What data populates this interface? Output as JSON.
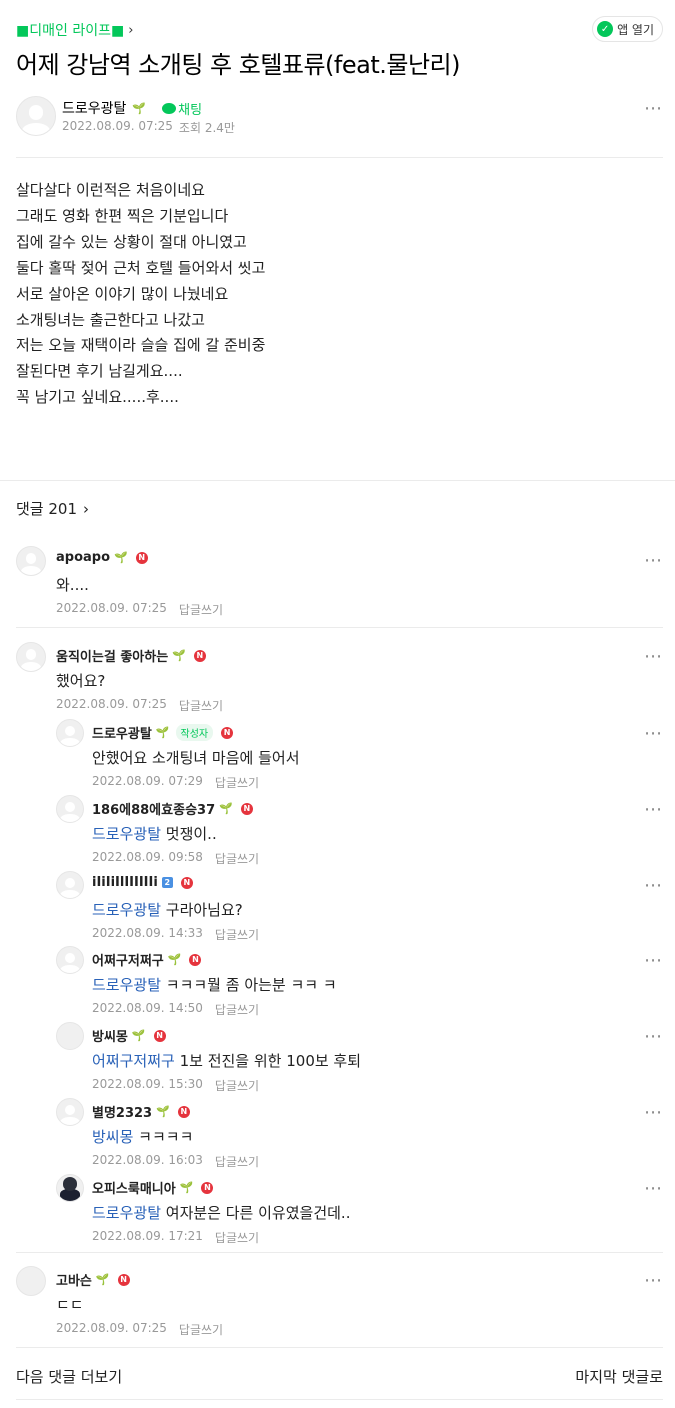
{
  "cafe": {
    "link_label": "■디매인 라이프■"
  },
  "app_button": {
    "label": "앱 열기"
  },
  "post": {
    "title": "어제 강남역 소개팅 후 호텔표류(feat.물난리)",
    "author": "드로우광탈",
    "chat_label": "채팅",
    "date": "2022.08.09. 07:25",
    "views": "조회 2.4만",
    "body": [
      "살다살다 이런적은 처음이네요",
      "그래도 영화 한편 찍은 기분입니다",
      "집에 갈수 있는 상황이 절대 아니였고",
      "둘다 홀딱 젖어 근처 호텔 들어와서 씻고",
      "서로 살아온 이야기 많이 나눴네요",
      "소개팅녀는 출근한다고 나갔고",
      "저는 오늘 재택이라 슬슬 집에 갈 준비중",
      "잘된다면 후기 남길게요....",
      "꼭 남기고 싶네요.....후...."
    ]
  },
  "comments_header": {
    "label": "댓글 201"
  },
  "reply_label": "답글쓰기",
  "writer_badge": "작성자",
  "n_badge": "N",
  "level_badge": "2",
  "comments": [
    {
      "nick": "apoapo",
      "text": "와....",
      "date": "2022.08.09. 07:25"
    },
    {
      "nick": "움직이는걸 좋아하는",
      "text": "했어요?",
      "date": "2022.08.09. 07:25"
    },
    {
      "nick": "드로우광탈",
      "text": "안했어요 소개팅녀 마음에 들어서",
      "date": "2022.08.09. 07:29"
    },
    {
      "nick": "186에88에효종승37",
      "mention": "드로우광탈",
      "text": " 멋쟁이..",
      "date": "2022.08.09. 09:58"
    },
    {
      "nick": "iIiIiIlIIIIIIi",
      "mention": "드로우광탈",
      "text": " 구라아님요?",
      "date": "2022.08.09. 14:33"
    },
    {
      "nick": "어쩌구저쩌구",
      "mention": "드로우광탈",
      "text": " ㅋㅋㅋ뭘 좀 아는분 ㅋㅋ ㅋ",
      "date": "2022.08.09. 14:50"
    },
    {
      "nick": "방씨몽",
      "mention": "어쩌구저쩌구",
      "text": " 1보 전진을 위한 100보 후퇴",
      "date": "2022.08.09. 15:30"
    },
    {
      "nick": "별명2323",
      "mention": "방씨몽",
      "text": " ㅋㅋㅋㅋ",
      "date": "2022.08.09. 16:03"
    },
    {
      "nick": "오피스룩매니아",
      "mention": "드로우광탈",
      "text": " 여자분은 다른 이유였을건데..",
      "date": "2022.08.09. 17:21"
    },
    {
      "nick": "고바슨",
      "text": "ㄷㄷ",
      "date": "2022.08.09. 07:25"
    }
  ],
  "footer": {
    "more_label": "다음 댓글 더보기",
    "last_label": "마지막 댓글로"
  },
  "colors": {
    "accent": "#03c75a",
    "mention": "#2a62b8",
    "n_badge": "#e5343d"
  }
}
